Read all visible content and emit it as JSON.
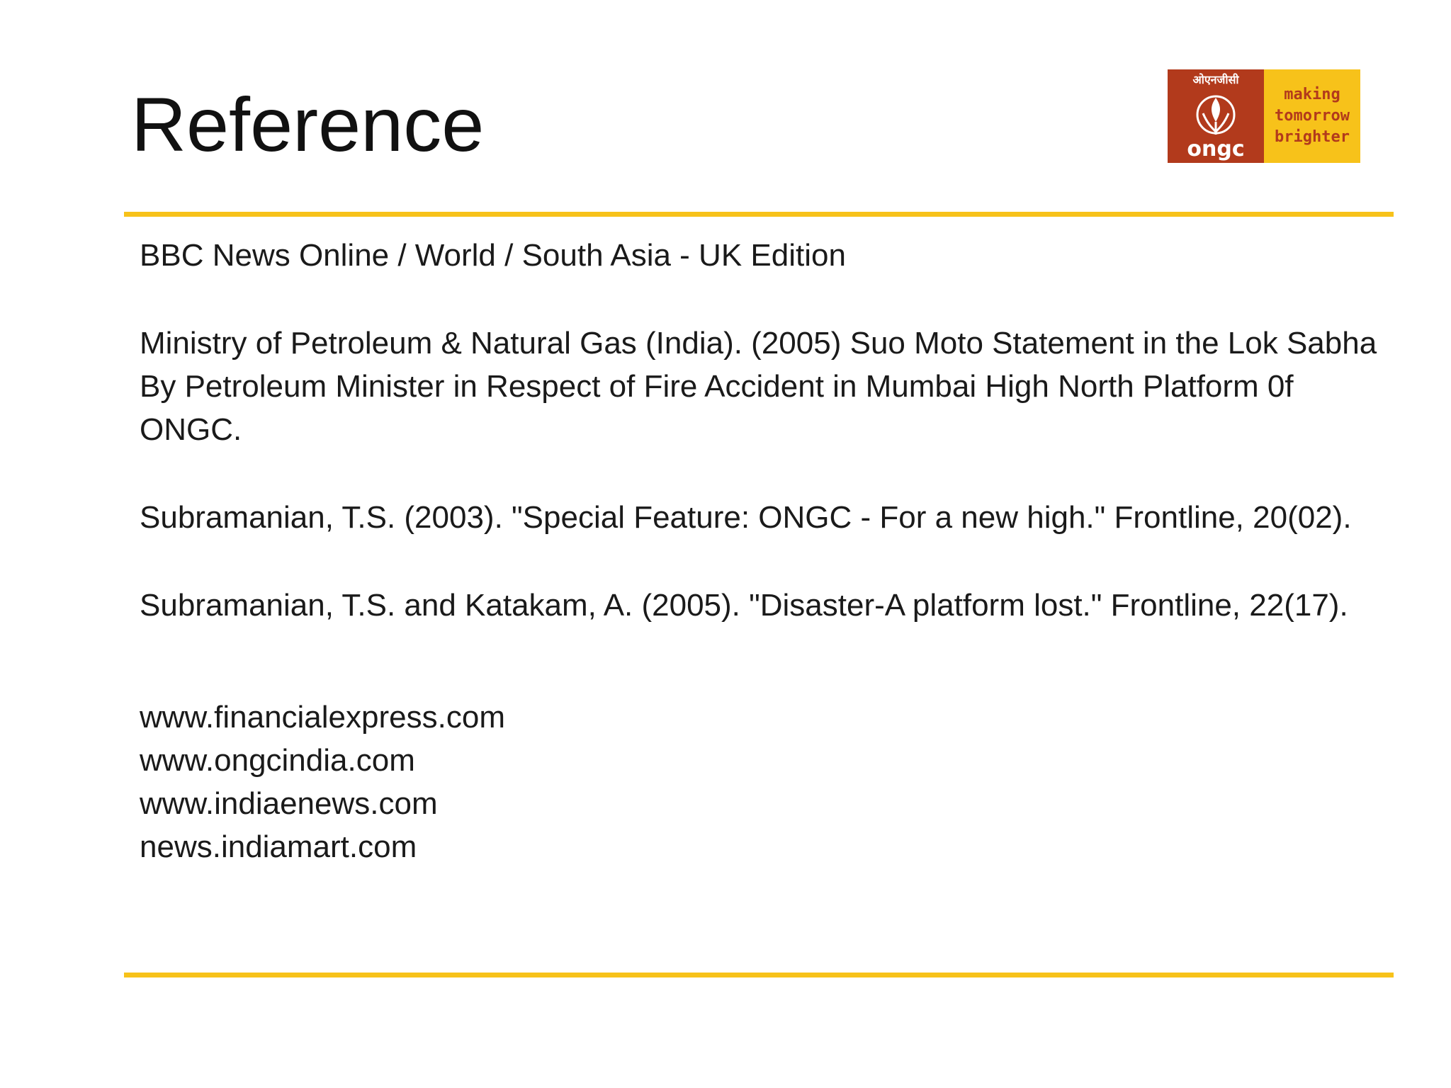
{
  "slide": {
    "title": "Reference",
    "accent_color": "#f7c21a",
    "logo": {
      "icon": "ongc-logo",
      "hindi_text": "ओएनजीसी",
      "brand": "ongc",
      "tagline": [
        "making",
        "tomorrow",
        "brighter"
      ],
      "brand_color": "#b23a1c",
      "tagline_bg": "#f7c21a"
    }
  },
  "references": {
    "bbc": "BBC News Online / World  / South Asia - UK Edition",
    "ministry": "Ministry of Petroleum & Natural Gas (India). (2005) Suo Moto Statement in the Lok Sabha By Petroleum  Minister in Respect of Fire Accident in Mumbai High North Platform 0f ONGC.",
    "subramanian_2003": "Subramanian, T.S. (2003). \"Special Feature: ONGC - For a new high.\" Frontline, 20(02).",
    "subramanian_2005": "Subramanian, T.S. and Katakam, A. (2005).  \"Disaster-A platform lost.\" Frontline, 22(17)."
  },
  "links": [
    "www.financialexpress.com",
    "www.ongcindia.com",
    "www.indiaenews.com",
    "news.indiamart.com"
  ]
}
